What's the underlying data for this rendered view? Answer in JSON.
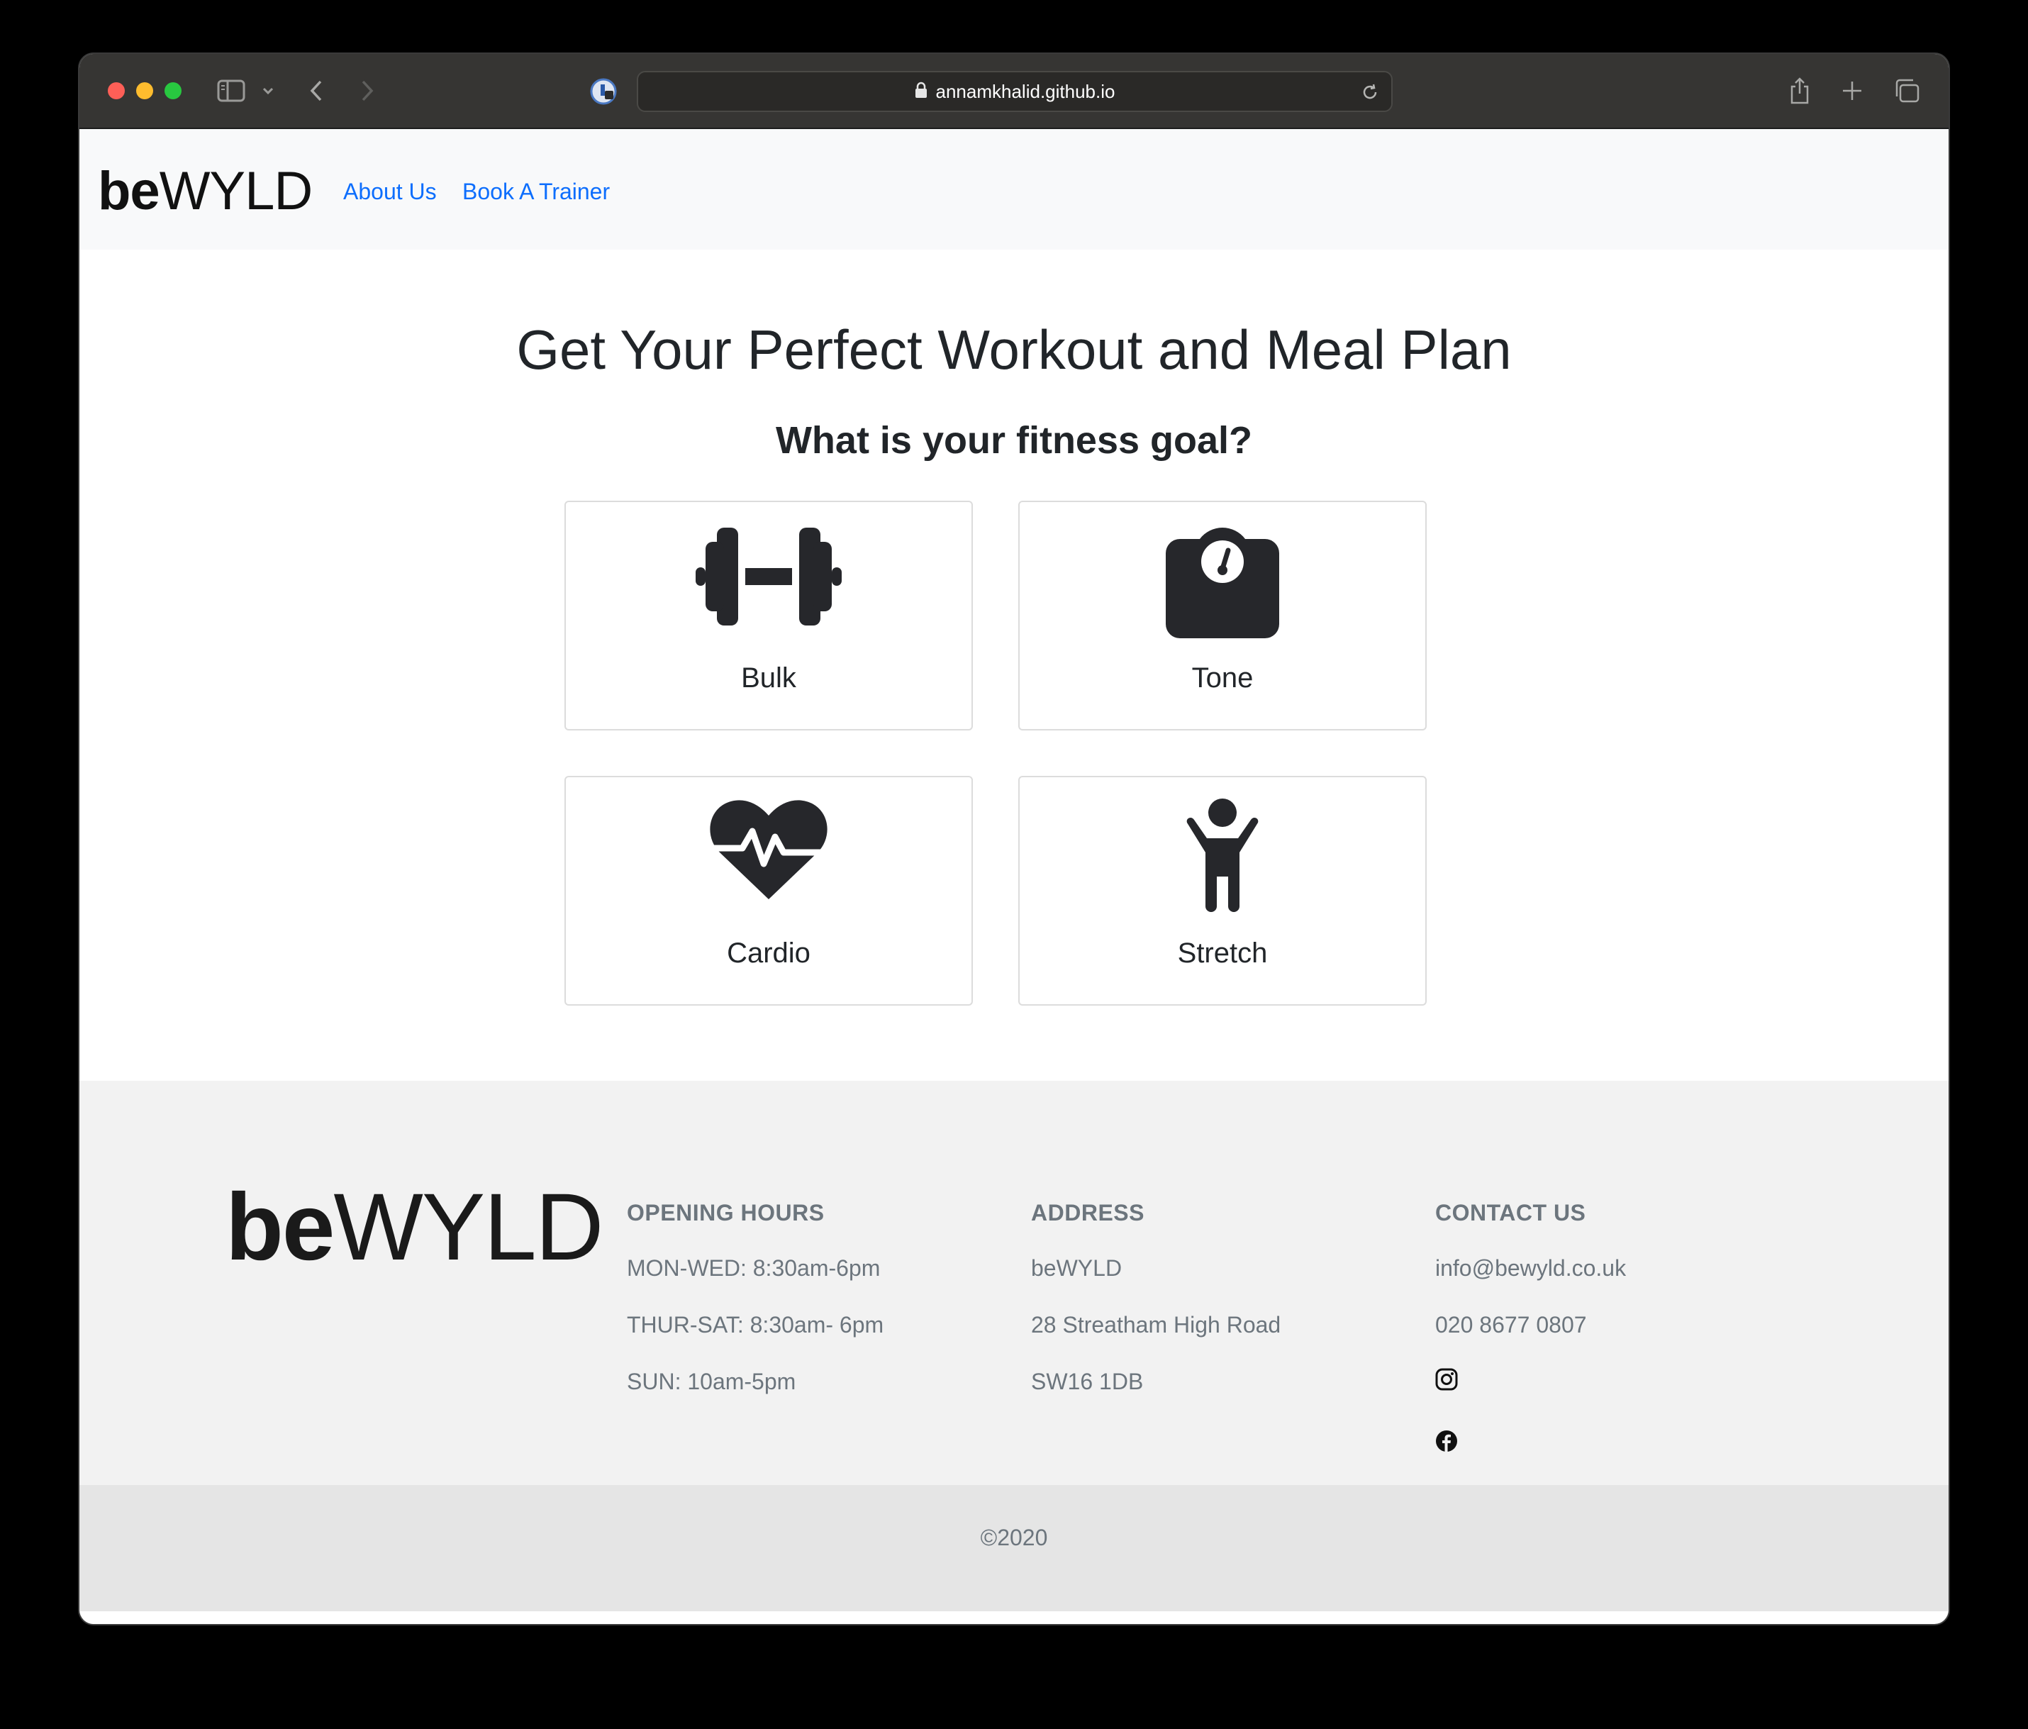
{
  "browser": {
    "url": "annamkhalid.github.io"
  },
  "nav": {
    "brand_bold": "be",
    "brand_light": "WYLD",
    "links": [
      "About Us",
      "Book A Trainer"
    ]
  },
  "main": {
    "title": "Get Your Perfect Workout and Meal Plan",
    "subtitle": "What is your fitness goal?",
    "goals": [
      {
        "label": "Bulk",
        "icon": "dumbbell-icon"
      },
      {
        "label": "Tone",
        "icon": "scale-icon"
      },
      {
        "label": "Cardio",
        "icon": "heart-pulse-icon"
      },
      {
        "label": "Stretch",
        "icon": "person-stretch-icon"
      }
    ]
  },
  "footer": {
    "brand_bold": "be",
    "brand_light": "WYLD",
    "hours": {
      "heading": "OPENING HOURS",
      "lines": [
        "MON-WED: 8:30am-6pm",
        "THUR-SAT: 8:30am- 6pm",
        "SUN: 10am-5pm"
      ]
    },
    "address": {
      "heading": "ADDRESS",
      "lines": [
        "beWYLD",
        "28 Streatham High Road",
        "SW16 1DB"
      ]
    },
    "contact": {
      "heading": "CONTACT US",
      "email": "info@bewyld.co.uk",
      "phone": "020 8677 0807"
    },
    "copyright": "©2020"
  },
  "colors": {
    "link": "#0d6efd",
    "icon": "#26272b",
    "footer_bg": "#f2f2f2",
    "copyright_bg": "#e5e5e5"
  }
}
